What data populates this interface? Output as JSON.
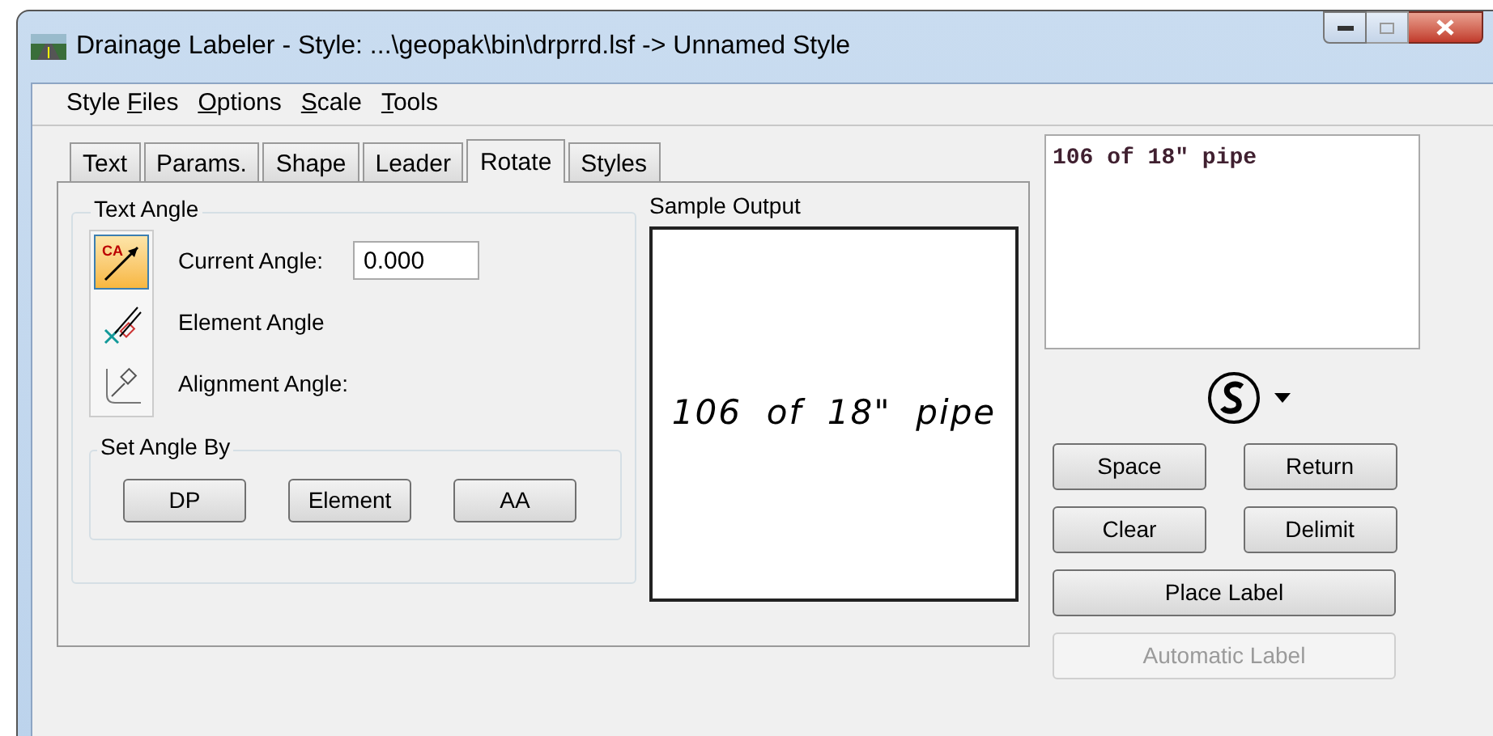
{
  "window": {
    "title": "Drainage Labeler - Style: ...\\geopak\\bin\\drprrd.lsf -> Unnamed Style"
  },
  "menu": [
    {
      "before": "Style ",
      "key": "F",
      "after": "iles"
    },
    {
      "key": "O",
      "after": "ptions"
    },
    {
      "key": "S",
      "after": "cale"
    },
    {
      "key": "T",
      "after": "ools"
    }
  ],
  "tabs": [
    {
      "label": "Text",
      "selected": false
    },
    {
      "label": "Params.",
      "selected": false
    },
    {
      "label": "Shape",
      "selected": false
    },
    {
      "label": "Leader",
      "selected": false
    },
    {
      "label": "Rotate",
      "selected": true
    },
    {
      "label": "Styles",
      "selected": false
    }
  ],
  "text_angle": {
    "title": "Text Angle",
    "modes": [
      {
        "kind": "current",
        "icon_text": "CA",
        "label": "Current Angle:",
        "value": "0.000",
        "selected": true
      },
      {
        "kind": "element",
        "label": "Element Angle",
        "selected": false
      },
      {
        "kind": "alignment",
        "label": "Alignment Angle:",
        "selected": false
      }
    ],
    "set_angle_by": {
      "title": "Set Angle By",
      "buttons": [
        "DP",
        "Element",
        "AA"
      ]
    }
  },
  "sample_output": {
    "title": "Sample Output",
    "text": "106 of 18\" pipe"
  },
  "label_text": "106 of 18\" pipe",
  "buttons": [
    {
      "label": "Space",
      "disabled": false
    },
    {
      "label": "Return",
      "disabled": false
    },
    {
      "label": "Clear",
      "disabled": false
    },
    {
      "label": "Delimit",
      "disabled": false
    },
    {
      "label": "Place Label",
      "disabled": false
    },
    {
      "label": "Automatic Label",
      "disabled": true
    }
  ]
}
